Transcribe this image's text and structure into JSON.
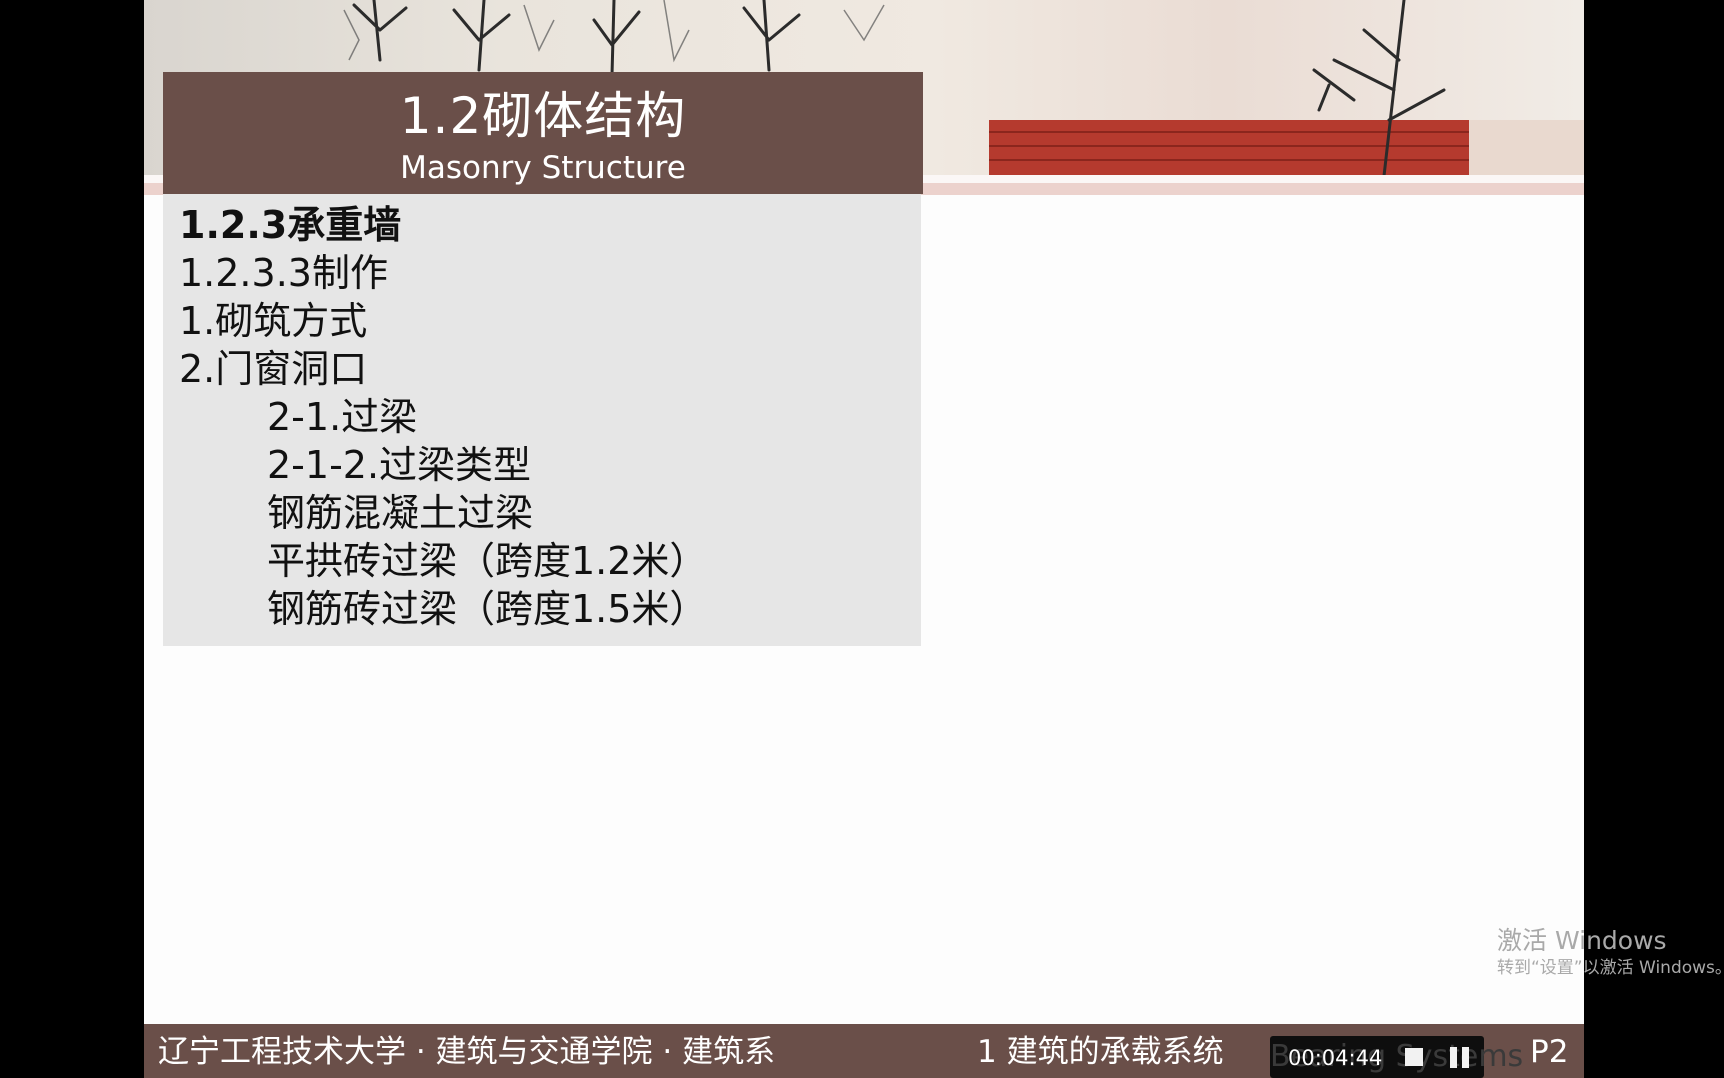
{
  "slide": {
    "title_cn": "1.2砌体结构",
    "title_en": "Masonry Structure",
    "lines": [
      {
        "text": "1.2.3承重墙",
        "bold": true
      },
      {
        "text": "1.2.3.3制作",
        "bold": false
      },
      {
        "text": "1.砌筑方式",
        "bold": false
      },
      {
        "text": "2.门窗洞口",
        "bold": false
      },
      {
        "text": "2-1.过梁",
        "bold": false
      },
      {
        "text": "2-1-2.过梁类型",
        "bold": false
      },
      {
        "text": "钢筋混凝土过梁",
        "bold": false
      },
      {
        "text": "平拱砖过梁（跨度1.2米）",
        "bold": false
      },
      {
        "text": "钢筋砖过梁（跨度1.5米）",
        "bold": false
      }
    ]
  },
  "footer": {
    "institution": "辽宁工程技术大学 · 建筑与交通学院 · 建筑系",
    "chapter": "1  建筑的承载系统",
    "chapter_en_partial": "Bearing Systems",
    "page": "P2"
  },
  "watermark": {
    "line1": "激活 Windows",
    "line2": "转到“设置”以激活 Windows。"
  },
  "player": {
    "time": "00:04:44",
    "stop_icon": "stop-icon",
    "pause_icon": "pause-icon"
  },
  "colors": {
    "brown": "#6a4f49",
    "content_bg": "#e6e6e6",
    "pink_rule": "#ecd2cd"
  }
}
